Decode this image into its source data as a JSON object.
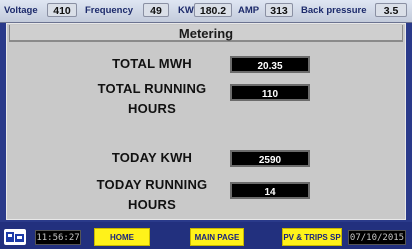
{
  "top": {
    "voltage_label": "Voltage",
    "voltage_value": "410",
    "frequency_label": "Frequency",
    "frequency_value": "49",
    "kw_label": "KW",
    "kw_value": "180.2",
    "amp_label": "AMP",
    "amp_value": "313",
    "backpressure_label": "Back pressure",
    "backpressure_value": "3.5"
  },
  "panel": {
    "title": "Metering",
    "metrics": [
      {
        "label_line1": "TOTAL MWH",
        "label_line2": "",
        "value": "20.35"
      },
      {
        "label_line1": "TOTAL RUNNING",
        "label_line2": "HOURS",
        "value": "110"
      },
      {
        "label_line1": "TODAY KWH",
        "label_line2": "",
        "value": "2590"
      },
      {
        "label_line1": "TODAY RUNNING",
        "label_line2": "HOURS",
        "value": "14"
      }
    ]
  },
  "bottom": {
    "logo_icon": "plant-logo-icon",
    "time": "11:56:27",
    "home_label": "HOME",
    "main_page_label": "MAIN PAGE",
    "pv_trips_label": "PV & TRIPS SP",
    "date": "07/10/2015"
  },
  "colors": {
    "background": "#2a3a8a",
    "panel": "#c9c9c9",
    "value_box": "#000000",
    "nav_button": "#fff21a"
  }
}
